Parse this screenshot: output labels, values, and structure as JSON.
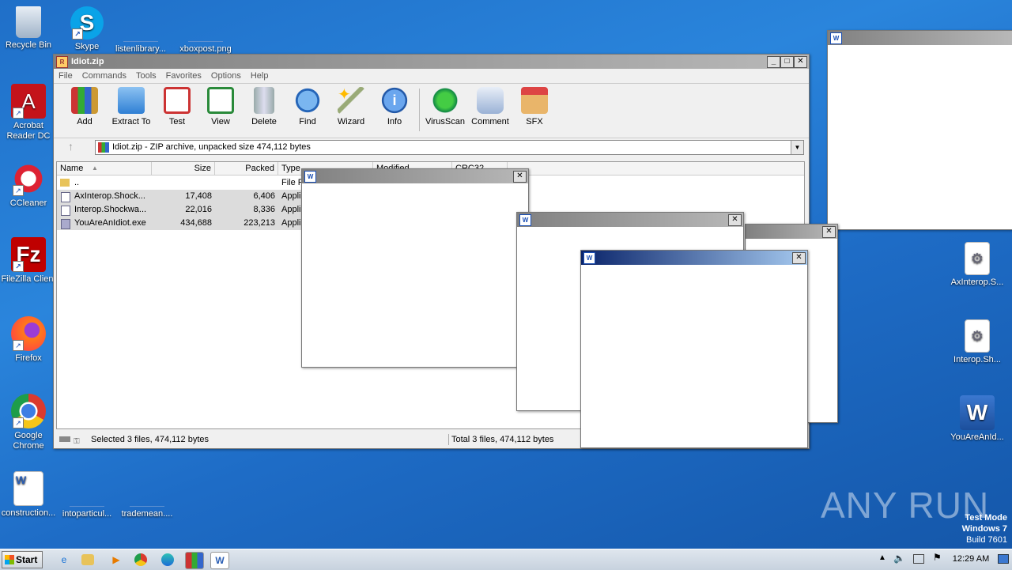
{
  "desktop": {
    "left_icons": [
      {
        "label": "Recycle Bin"
      },
      {
        "label": "Skype"
      },
      {
        "label": "listenlibrary..."
      },
      {
        "label": "xboxpost.png"
      },
      {
        "label": "Acrobat Reader DC"
      },
      {
        "label": "CCleaner"
      },
      {
        "label": "FileZilla Client"
      },
      {
        "label": "Firefox"
      },
      {
        "label": "Google Chrome"
      },
      {
        "label": "construction..."
      },
      {
        "label": "intoparticul..."
      },
      {
        "label": "trademean...."
      }
    ],
    "right_icons": [
      {
        "label": "AxInterop.S..."
      },
      {
        "label": "Interop.Sh..."
      },
      {
        "label": "YouAreAnId..."
      }
    ],
    "watermark": "ANY RUN",
    "test_mode": {
      "line1": "Test Mode",
      "line2": "Windows 7",
      "line3": "Build 7601"
    }
  },
  "winrar": {
    "title": "Idiot.zip",
    "menu": [
      "File",
      "Commands",
      "Tools",
      "Favorites",
      "Options",
      "Help"
    ],
    "tools": [
      {
        "label": "Add",
        "icon": "add-icon"
      },
      {
        "label": "Extract To",
        "icon": "extract-folder-icon"
      },
      {
        "label": "Test",
        "icon": "test-clipboard-icon"
      },
      {
        "label": "View",
        "icon": "view-book-icon"
      },
      {
        "label": "Delete",
        "icon": "delete-trash-icon"
      },
      {
        "label": "Find",
        "icon": "find-magnifier-icon"
      },
      {
        "label": "Wizard",
        "icon": "wizard-wand-icon"
      },
      {
        "label": "Info",
        "icon": "info-icon"
      },
      {
        "label": "VirusScan",
        "icon": "virusscan-bug-icon"
      },
      {
        "label": "Comment",
        "icon": "comment-icon"
      },
      {
        "label": "SFX",
        "icon": "sfx-box-icon"
      }
    ],
    "address": "Idiot.zip - ZIP archive, unpacked size 474,112 bytes",
    "columns": [
      "Name",
      "Size",
      "Packed",
      "Type",
      "Modified",
      "CRC32"
    ],
    "rows": [
      {
        "name": "..",
        "size": "",
        "packed": "",
        "type": "File F"
      },
      {
        "name": "AxInterop.Shock...",
        "size": "17,408",
        "packed": "6,406",
        "type": "Appli"
      },
      {
        "name": "Interop.Shockwa...",
        "size": "22,016",
        "packed": "8,336",
        "type": "Appli"
      },
      {
        "name": "YouAreAnIdiot.exe",
        "size": "434,688",
        "packed": "223,213",
        "type": "Appli"
      }
    ],
    "status_left": "Selected 3 files, 474,112 bytes",
    "status_right": "Total 3 files, 474,112 bytes"
  },
  "taskbar": {
    "start": "Start",
    "clock": "12:29 AM"
  }
}
